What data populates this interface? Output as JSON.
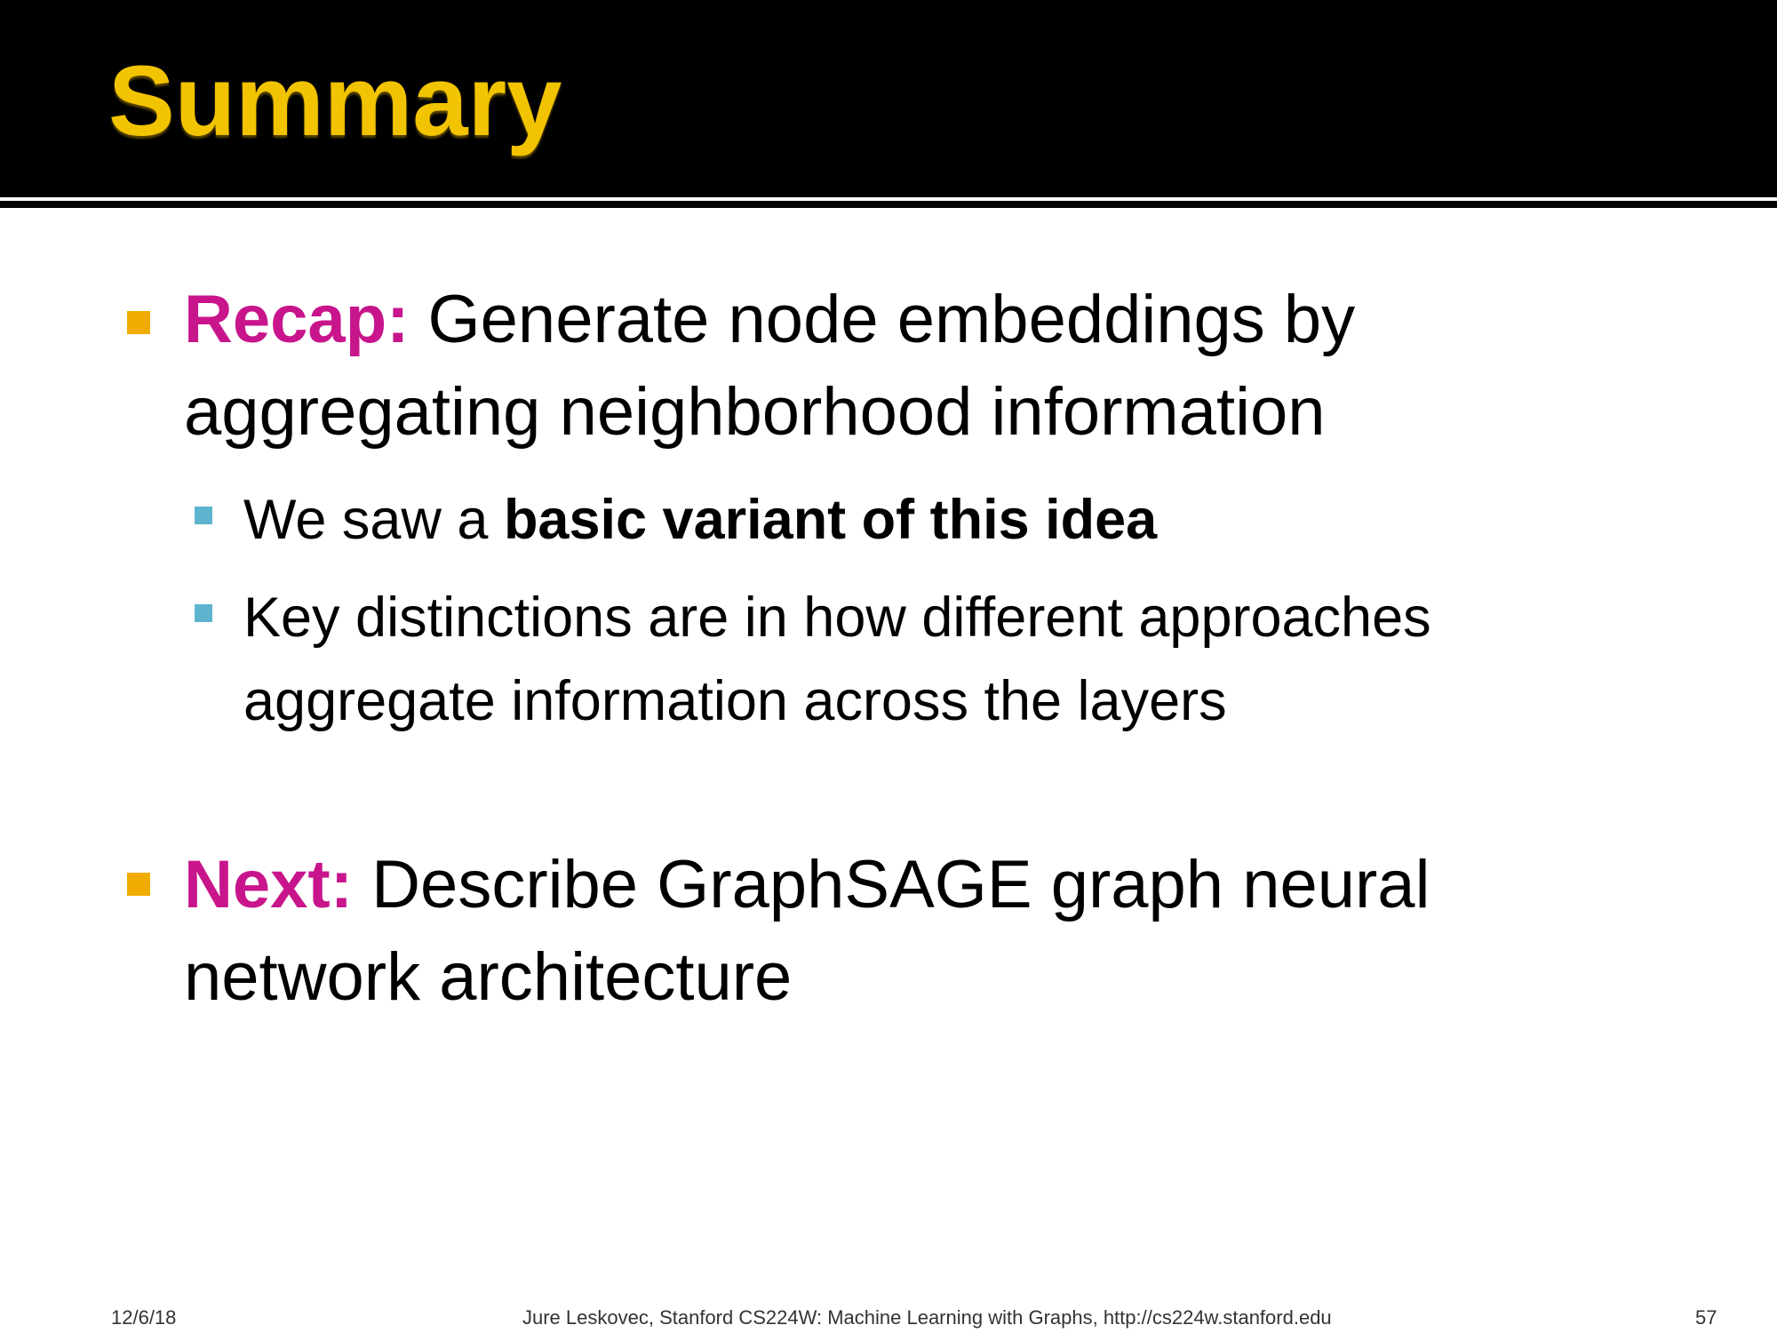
{
  "slide": {
    "title": "Summary",
    "bullets": {
      "recap": {
        "keyword": "Recap:",
        "line1": "Generate node embeddings by",
        "line2": "aggregating neighborhood information"
      },
      "sub1": {
        "prefix": "We saw a ",
        "bold": "basic variant of this idea"
      },
      "sub2": {
        "line1": "Key distinctions are in how different approaches",
        "line2": "aggregate information across the layers"
      },
      "next": {
        "keyword": "Next:",
        "line1": "Describe GraphSAGE graph neural",
        "line2": "network architecture"
      }
    },
    "footer": {
      "date": "12/6/18",
      "credit": "Jure Leskovec, Stanford CS224W: Machine Learning with Graphs, http://cs224w.stanford.edu",
      "page": "57"
    }
  },
  "colors": {
    "title": "#f2c300",
    "keyword": "#c8158c",
    "bullet_level1": "#f0ac00",
    "bullet_level2": "#5eb4cf",
    "header_background": "#000000"
  }
}
